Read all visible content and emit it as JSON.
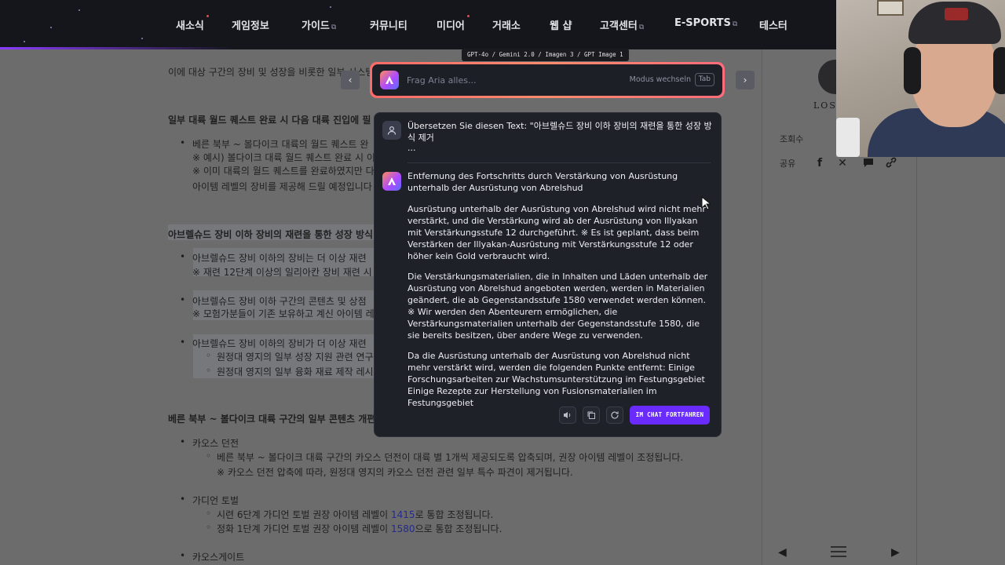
{
  "nav": {
    "items": [
      "새소식",
      "게임정보",
      "가이드",
      "커뮤니티",
      "미디어",
      "거래소",
      "웹 샵",
      "고객센터",
      "E-SPORTS",
      "테스터"
    ]
  },
  "article": {
    "intro": "이에 대상 구간의 장비 및 성장을 비롯한 일부 시스템",
    "section1_heading": "일부 대륙 월드 퀘스트 완료 시 다음 대륙 진입에 필",
    "s1_b1": "베른 북부 ~ 볼다이크 대륙의 월드 퀘스트 완",
    "s1_n1": "※ 예시) 볼다이크 대륙 월드 퀘스트 완료 시 이",
    "s1_n2": "※ 이미 대륙의 월드 퀘스트를 완료하였지만 다",
    "s1_n3": "아이템 레벨의 장비를 제공해 드릴 예정입니다",
    "section2_heading": "아브렐슈드 장비 이하 장비의 재련을 통한 성장 방식",
    "s2_b1": "아브렐슈드 장비 이하의 장비는 더 이상 재련",
    "s2_n1": "※ 재련 12단계 이상의 일리아칸 장비 재련 시",
    "s2_b2": "아브렐슈드 장비 이하 구간의 콘텐츠 및 상점",
    "s2_n2": "※ 모험가분들이 기존 보유하고 계신 아이템 레",
    "s2_b3": "아브렐슈드 장비 이하의 장비가 더 이상 재련",
    "s2_sub1": "원정대 영지의 일부 성장 지원 관련 연구",
    "s2_sub2": "원정대 영지의 일부 융화 재료 제작 레시",
    "section3_heading": "베른 북부 ~ 볼다이크 대륙 구간의 일부 콘텐츠 개편",
    "s3_b1": "카오스 던전",
    "s3_b1_sub": "베른 북부 ~ 볼다이크 대륙 구간의 카오스 던전이 대륙 별 1개씩 제공되도록 압축되며, 권장 아이템 레벨이 조정됩니다.",
    "s3_b1_note": "※ 카오스 던전 압축에 따라, 원정대 영지의 카오스 던전 관련 일부 특수 파견이 제거됩니다.",
    "s3_b2": "가디언 토벌",
    "s3_b2_sub1_pre": "시련 6단계 가디언 토벌 권장 아이템 레벨이",
    "s3_b2_sub1_num": "1415",
    "s3_b2_sub1_post": "로 통합 조정됩니다.",
    "s3_b2_sub2_pre": "정화 1단계 가디언 토벌 권장 아이템 레벨이",
    "s3_b2_sub2_num": "1580",
    "s3_b2_sub2_post": "으로 통합 조정됩니다.",
    "s3_b3": "카오스게이트"
  },
  "sidebar": {
    "logo_text": "LOST",
    "views_label": "조회수",
    "share_label": "공유"
  },
  "aria": {
    "model_tag": "GPT-4o / Gemini 2.0 / Imagen 3 / GPT Image 1",
    "search_placeholder": "Frag Aria alles...",
    "mode_switch": "Modus wechseln",
    "tab_key": "Tab",
    "user_message": "Übersetzen Sie diesen Text: \"아브렐슈드 장비 이하 장비의 재련을 통한 성장 방식 제거",
    "user_ellipsis": "...",
    "ai_title": "Entfernung des Fortschritts durch Verstärkung von Ausrüstung unterhalb der Ausrüstung von Abrelshud",
    "ai_p1": "Ausrüstung unterhalb der Ausrüstung von Abrelshud wird nicht mehr verstärkt, und die Verstärkung wird ab der Ausrüstung von Illyakan mit Verstärkungsstufe 12 durchgeführt. ※ Es ist geplant, dass beim Verstärken der Illyakan-Ausrüstung mit Verstärkungsstufe 12 oder höher kein Gold verbraucht wird.",
    "ai_p2": "Die Verstärkungsmaterialien, die in Inhalten und Läden unterhalb der Ausrüstung von Abrelshud angeboten werden, werden in Materialien geändert, die ab Gegenstandsstufe 1580 verwendet werden können. ※ Wir werden den Abenteurern ermöglichen, die Verstärkungsmaterialien unterhalb der Gegenstandsstufe 1580, die sie bereits besitzen, über andere Wege zu verwenden.",
    "ai_p3": "Da die Ausrüstung unterhalb der Ausrüstung von Abrelshud nicht mehr verstärkt wird, werden die folgenden Punkte entfernt: Einige Forschungsarbeiten zur Wachstumsunterstützung im Festungsgebiet Einige Rezepte zur Herstellung von Fusionsmaterialien im Festungsgebiet",
    "continue_label": "IM CHAT FORTFAHREN"
  },
  "colors": {
    "accent": "#6a2bff",
    "search_border": "#ff7a6b",
    "panel_bg": "#1f2129"
  }
}
